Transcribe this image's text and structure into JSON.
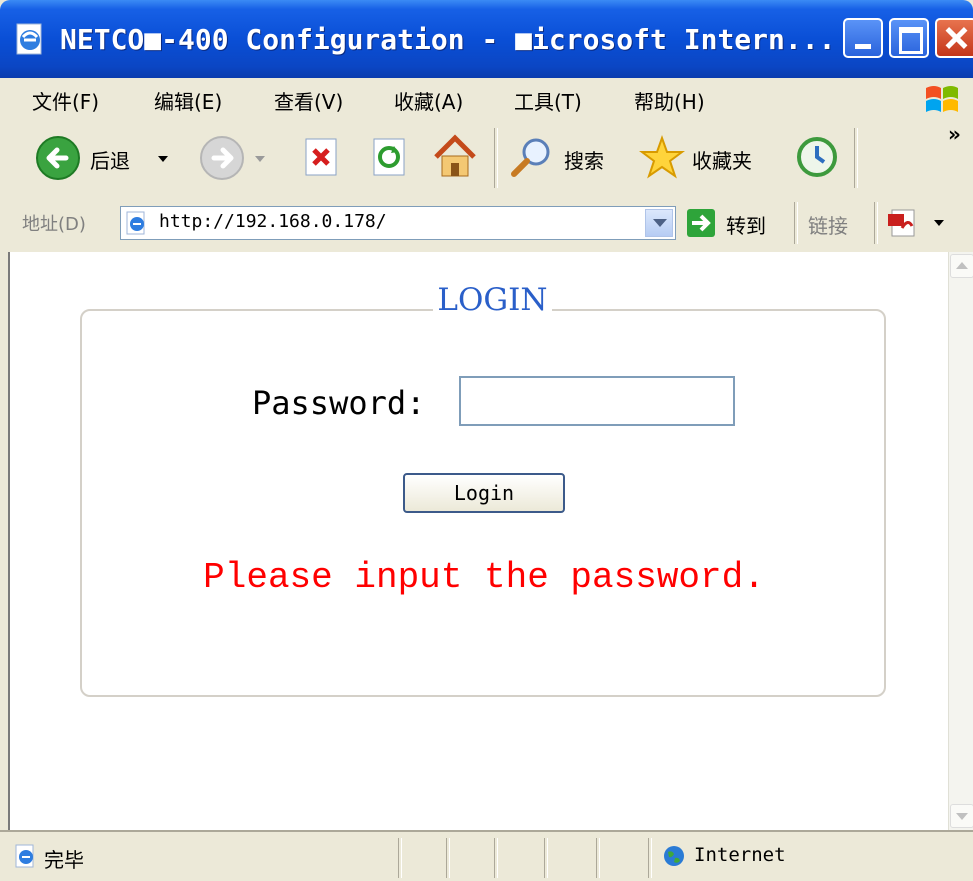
{
  "window": {
    "title": "NETCO■-400 Configuration - ■icrosoft Intern..."
  },
  "menubar": {
    "items": [
      "文件(F)",
      "编辑(E)",
      "查看(V)",
      "收藏(A)",
      "工具(T)",
      "帮助(H)"
    ]
  },
  "toolbar": {
    "back_label": "后退",
    "search_label": "搜索",
    "favorites_label": "收藏夹",
    "chevron": "»"
  },
  "addressbar": {
    "label": "地址(D)",
    "url": "http://192.168.0.178/",
    "go_label": "转到",
    "links_label": "链接"
  },
  "page": {
    "legend": "LOGIN",
    "password_label": "Password:",
    "password_value": "",
    "login_button": "Login",
    "message": "Please input the password.",
    "message_color": "#ff0000",
    "legend_color": "#2a5fc9"
  },
  "statusbar": {
    "status": "完毕",
    "zone": "Internet"
  },
  "icons": [
    "ie-page-icon",
    "windows-flag-icon",
    "back-arrow-icon",
    "forward-arrow-icon",
    "stop-icon",
    "refresh-icon",
    "home-icon",
    "search-magnifier-icon",
    "favorites-star-icon",
    "history-icon",
    "go-arrow-icon",
    "pdf-icon",
    "globe-icon"
  ]
}
